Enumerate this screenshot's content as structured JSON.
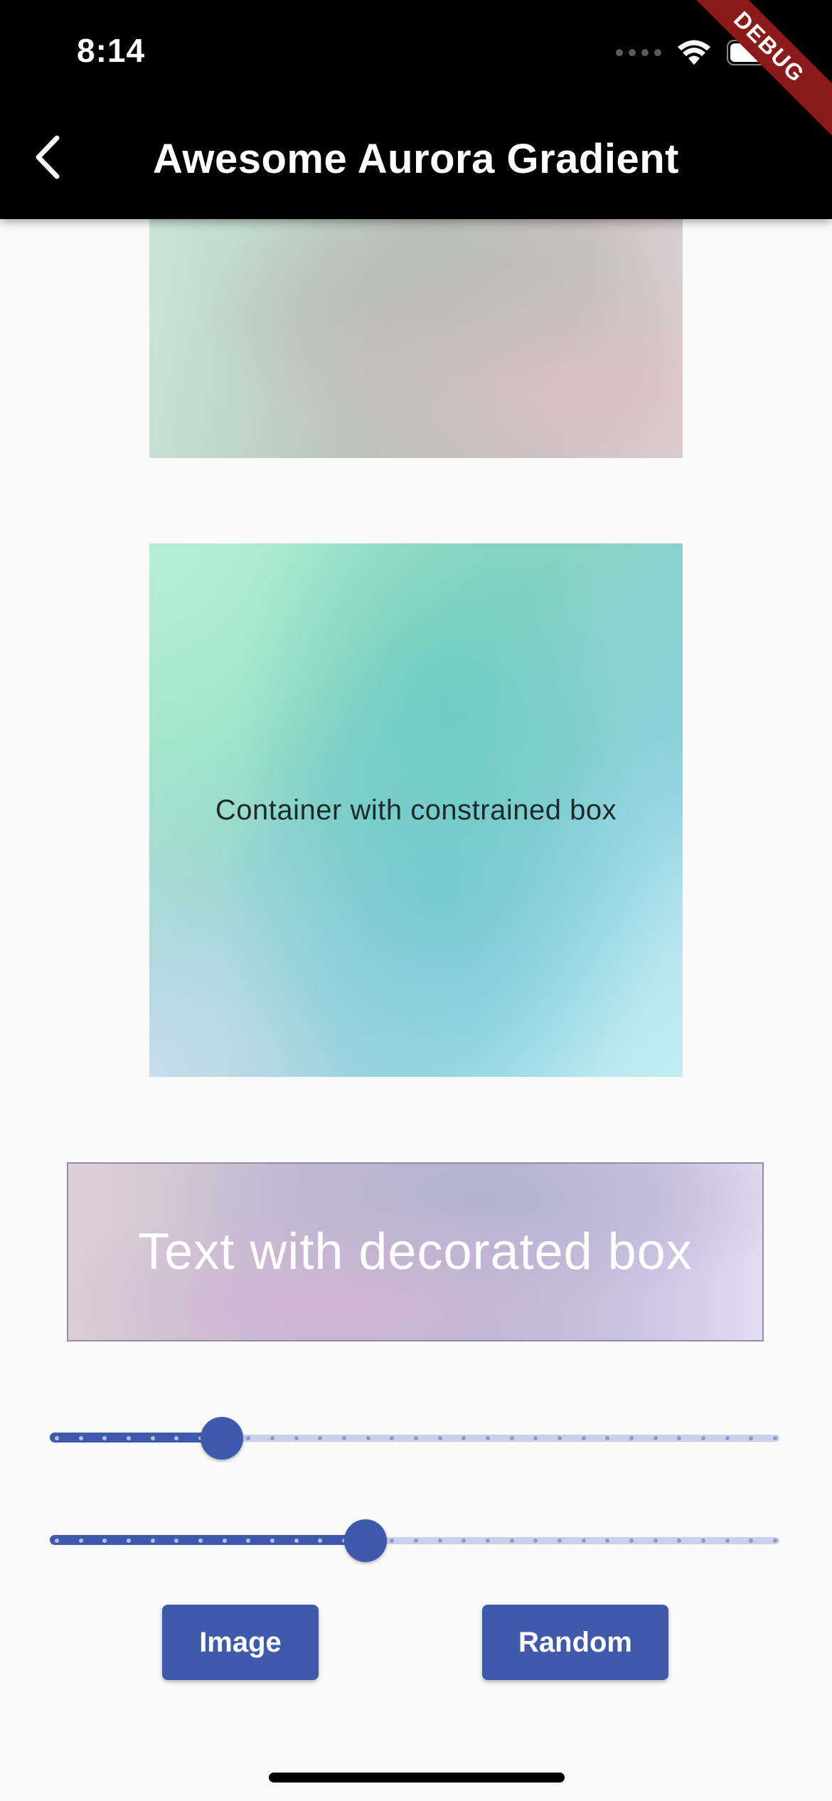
{
  "status_bar": {
    "time": "8:14"
  },
  "debug_banner": "DEBUG",
  "app_bar": {
    "title": "Awesome Aurora Gradient",
    "back_icon": "chevron-left-icon"
  },
  "panels": {
    "constrained_box_label": "Container with constrained box",
    "decorated_box_label": "Text with decorated box"
  },
  "sliders": [
    {
      "name": "slider-1",
      "value": 0.23,
      "divisions": 30
    },
    {
      "name": "slider-2",
      "value": 0.43,
      "divisions": 30
    }
  ],
  "buttons": {
    "image_label": "Image",
    "random_label": "Random"
  },
  "colors": {
    "accent": "#3f5aab",
    "track_inactive": "#c9d1ea",
    "app_bar": "#000000",
    "background": "#fafafa",
    "debug_ribbon": "#8b1a1a"
  }
}
